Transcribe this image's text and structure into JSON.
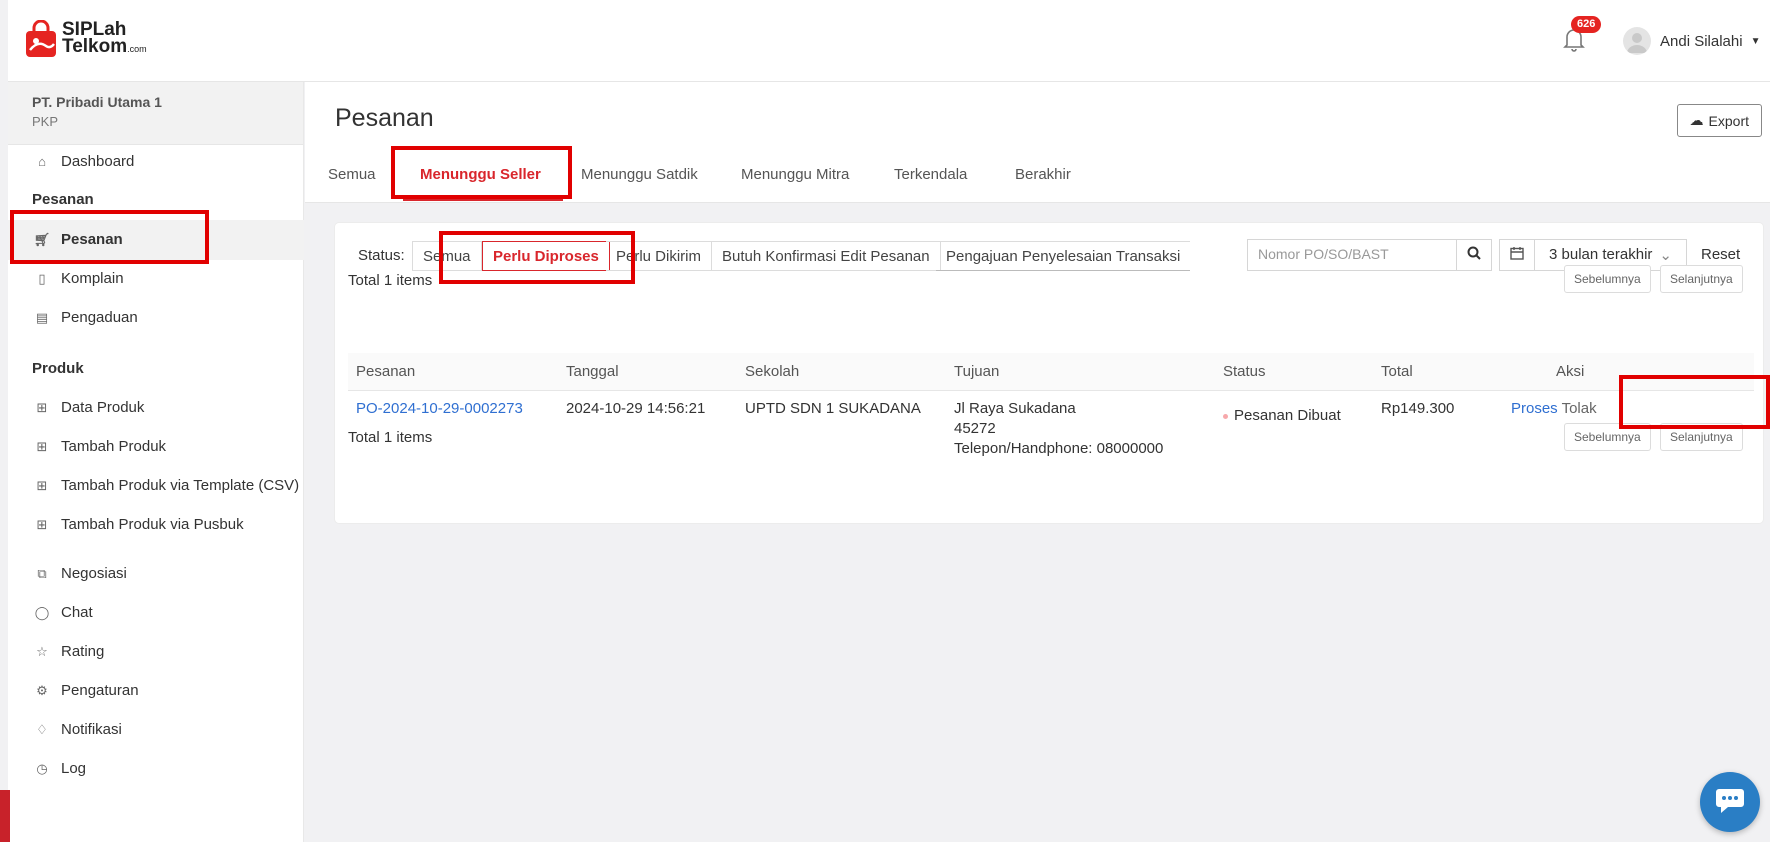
{
  "header": {
    "brand_line1": "SIPLah",
    "brand_line2": "Telkom",
    "brand_suffix": ".com",
    "notification_count": "626",
    "user_name": "Andi Silalahi"
  },
  "sidebar": {
    "company_name": "PT. Pribadi Utama 1",
    "company_type": "PKP",
    "items": [
      {
        "label": "Dashboard",
        "icon": "home-icon"
      },
      {
        "label": "Pesanan",
        "type": "section"
      },
      {
        "label": "Pesanan",
        "icon": "cart-icon",
        "active": true
      },
      {
        "label": "Komplain",
        "icon": "document-icon"
      },
      {
        "label": "Pengaduan",
        "icon": "report-icon"
      },
      {
        "label": "Produk",
        "type": "section"
      },
      {
        "label": "Data Produk",
        "icon": "grid-icon"
      },
      {
        "label": "Tambah Produk",
        "icon": "grid-plus-icon"
      },
      {
        "label": "Tambah Produk via Template (CSV)",
        "icon": "grid-plus-icon"
      },
      {
        "label": "Tambah Produk via Pusbuk",
        "icon": "grid-plus-icon"
      },
      {
        "label": "Negosiasi",
        "icon": "copy-icon"
      },
      {
        "label": "Chat",
        "icon": "chat-icon"
      },
      {
        "label": "Rating",
        "icon": "star-icon"
      },
      {
        "label": "Pengaturan",
        "icon": "gear-icon"
      },
      {
        "label": "Notifikasi",
        "icon": "bell-icon"
      },
      {
        "label": "Log",
        "icon": "clock-icon"
      }
    ]
  },
  "page": {
    "title": "Pesanan",
    "export_label": "Export",
    "tabs": [
      "Semua",
      "Menunggu Seller",
      "Menunggu Satdik",
      "Menunggu Mitra",
      "Terkendala",
      "Berakhir"
    ],
    "active_tab": "Menunggu Seller"
  },
  "filters": {
    "status_label": "Status:",
    "segments": [
      "Semua",
      "Perlu Diproses",
      "Perlu Dikirim",
      "Butuh Konfirmasi Edit Pesanan",
      "Pengajuan Penyelesaian Transaksi"
    ],
    "active_segment": "Perlu Diproses",
    "search_placeholder": "Nomor PO/SO/BAST",
    "date_range": "3 bulan terakhir",
    "reset_label": "Reset"
  },
  "pagination": {
    "total_text": "Total 1 items",
    "prev_label": "Sebelumnya",
    "next_label": "Selanjutnya"
  },
  "table": {
    "columns": [
      "Pesanan",
      "Tanggal",
      "Sekolah",
      "Tujuan",
      "Status",
      "Total",
      "Aksi"
    ],
    "rows": [
      {
        "pesanan": "PO-2024-10-29-0002273",
        "tanggal": "2024-10-29 14:56:21",
        "sekolah": "UPTD SDN 1 SUKADANA",
        "tujuan_line1": "Jl Raya Sukadana",
        "tujuan_line2": "45272",
        "tujuan_line3": "Telepon/Handphone: 08000000",
        "status": "Pesanan Dibuat",
        "total": "Rp149.300",
        "action_primary": "Proses",
        "action_secondary": "Tolak"
      }
    ]
  },
  "colors": {
    "accent": "#d9262c",
    "link": "#2f6fd1",
    "annotation": "#e10000",
    "chat_button": "#2a7ec5"
  }
}
